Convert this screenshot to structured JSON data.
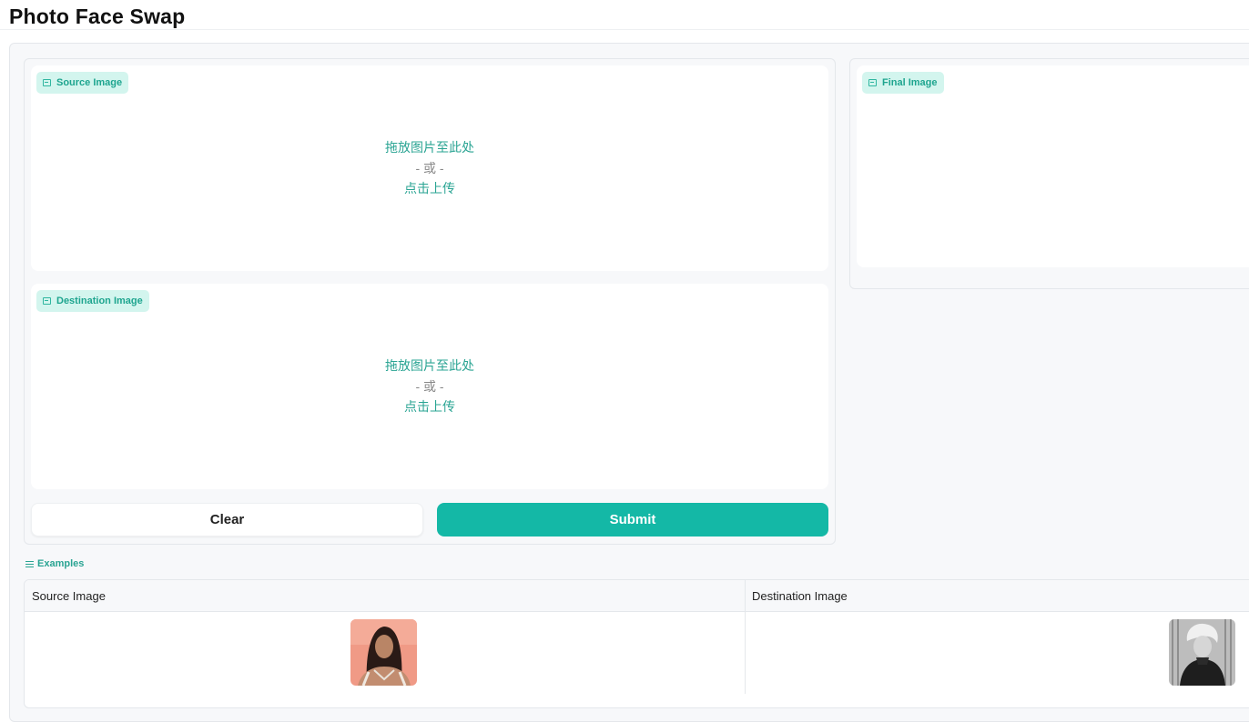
{
  "header": {
    "title": "Photo Face Swap"
  },
  "inputs": {
    "source": {
      "label": "Source Image",
      "drop_text": "拖放图片至此处",
      "or_text": "- 或 -",
      "click_text": "点击上传"
    },
    "destination": {
      "label": "Destination Image",
      "drop_text": "拖放图片至此处",
      "or_text": "- 或 -",
      "click_text": "点击上传"
    }
  },
  "output": {
    "label": "Final Image"
  },
  "buttons": {
    "clear": "Clear",
    "submit": "Submit"
  },
  "examples": {
    "label": "Examples",
    "columns": [
      "Source Image",
      "Destination Image"
    ],
    "rows": [
      {
        "source_thumb": "woman-portrait-photo",
        "destination_thumb": "bw-portrait-photo"
      }
    ]
  },
  "colors": {
    "accent": "#14b8a6",
    "chip_bg": "#d3f5ee",
    "chip_text": "#1ea58f"
  }
}
